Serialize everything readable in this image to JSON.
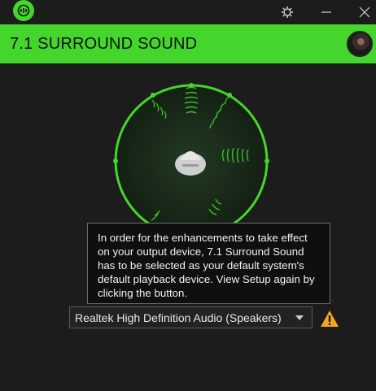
{
  "window": {
    "logo_icon": "razer-surround-logo-icon",
    "controls": [
      "gear-icon",
      "minimize-icon",
      "close-icon"
    ]
  },
  "header": {
    "title": "7.1 SURROUND SOUND",
    "accent_color": "#44d62c",
    "avatar_icon": "user-avatar"
  },
  "visualizer": {
    "ring_color": "#44d62c",
    "center_icon": "head-icon"
  },
  "tooltip": {
    "text": "In order for the enhancements to take effect on your output device, 7.1 Surround Sound has to be selected as your default system's default playback device. View Setup again by clicking the button."
  },
  "device": {
    "selected": "Realtek High Definition Audio (Speakers)",
    "warning_icon": "warning-icon",
    "warning_color": "#f5a623"
  }
}
